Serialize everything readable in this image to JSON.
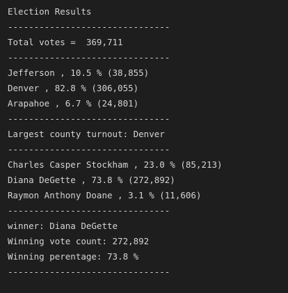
{
  "output": {
    "title": "Election Results",
    "divider": "-------------------------------",
    "total_votes": "Total votes =  369,711",
    "counties": [
      "Jefferson , 10.5 % (38,855)",
      "Denver , 82.8 % (306,055)",
      "Arapahoe , 6.7 % (24,801)"
    ],
    "largest_turnout": "Largest county turnout: Denver",
    "candidates": [
      "Charles Casper Stockham , 23.0 % (85,213)",
      "Diana DeGette , 73.8 % (272,892)",
      "Raymon Anthony Doane , 3.1 % (11,606)"
    ],
    "winner": "winner: Diana DeGette",
    "winning_count": "Winning vote count: 272,892",
    "winning_percentage": "Winning perentage: 73.8 %"
  },
  "colors": {
    "background": "#1e1e1e",
    "text": "#d4d4d4"
  }
}
